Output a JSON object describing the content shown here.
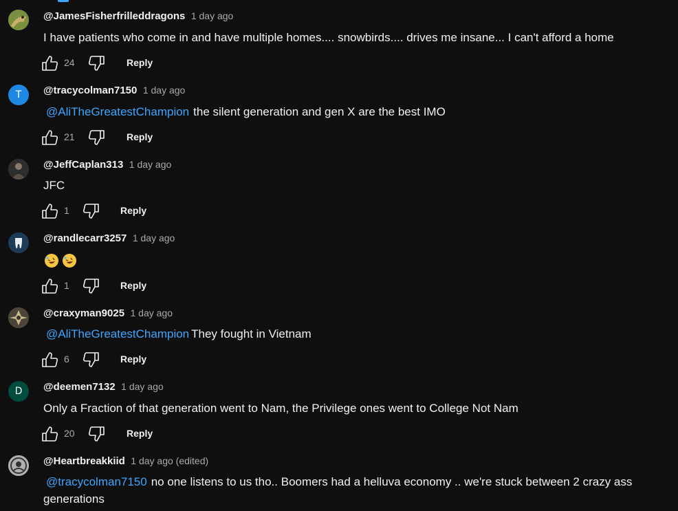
{
  "comments": [
    {
      "author": "@JamesFisherfrilleddragons",
      "time": "1 day ago",
      "mention": "",
      "text": "I have patients who come in and have multiple homes.... snowbirds.... drives me insane... I can't afford a home",
      "likes": "24",
      "reply": "Reply",
      "avatar_letter": "",
      "avatar_color": "#6b7d3a"
    },
    {
      "author": "@tracycolman7150",
      "time": "1 day ago",
      "mention": "@AliTheGreatestChampion",
      "text": "the silent generation and gen X are the best IMO",
      "likes": "21",
      "reply": "Reply",
      "avatar_letter": "T",
      "avatar_color": "#1e88e5"
    },
    {
      "author": "@JeffCaplan313",
      "time": "1 day ago",
      "mention": "",
      "text": "JFC",
      "likes": "1",
      "reply": "Reply",
      "avatar_letter": "",
      "avatar_color": "#3a3a3a"
    },
    {
      "author": "@randlecarr3257",
      "time": "1 day ago",
      "mention": "",
      "text": "",
      "likes": "1",
      "reply": "Reply",
      "avatar_letter": "",
      "avatar_color": "#23405e"
    },
    {
      "author": "@craxyman9025",
      "time": "1 day ago",
      "mention": "@AliTheGreatestChampion",
      "text": "They fought in Vietnam",
      "likes": "6",
      "reply": "Reply",
      "avatar_letter": "",
      "avatar_color": "#6e6452"
    },
    {
      "author": "@deemen7132",
      "time": "1 day ago",
      "mention": "",
      "text": "Only a Fraction of that generation went to Nam, the Privilege ones went to College Not Nam",
      "likes": "20",
      "reply": "Reply",
      "avatar_letter": "D",
      "avatar_color": "#004d40"
    },
    {
      "author": "@Heartbreakkiid",
      "time": "1 day ago (edited)",
      "mention": "@tracycolman7150",
      "text": "no one listens to us tho.. Boomers had a helluva economy .. we're stuck between 2 crazy ass generations",
      "likes": "",
      "reply": "",
      "avatar_letter": "",
      "avatar_color": "#9a9a9a"
    }
  ],
  "icons": {
    "like": "thumbs-up-icon",
    "dislike": "thumbs-down-icon",
    "emoji": "rofl-emoji"
  }
}
